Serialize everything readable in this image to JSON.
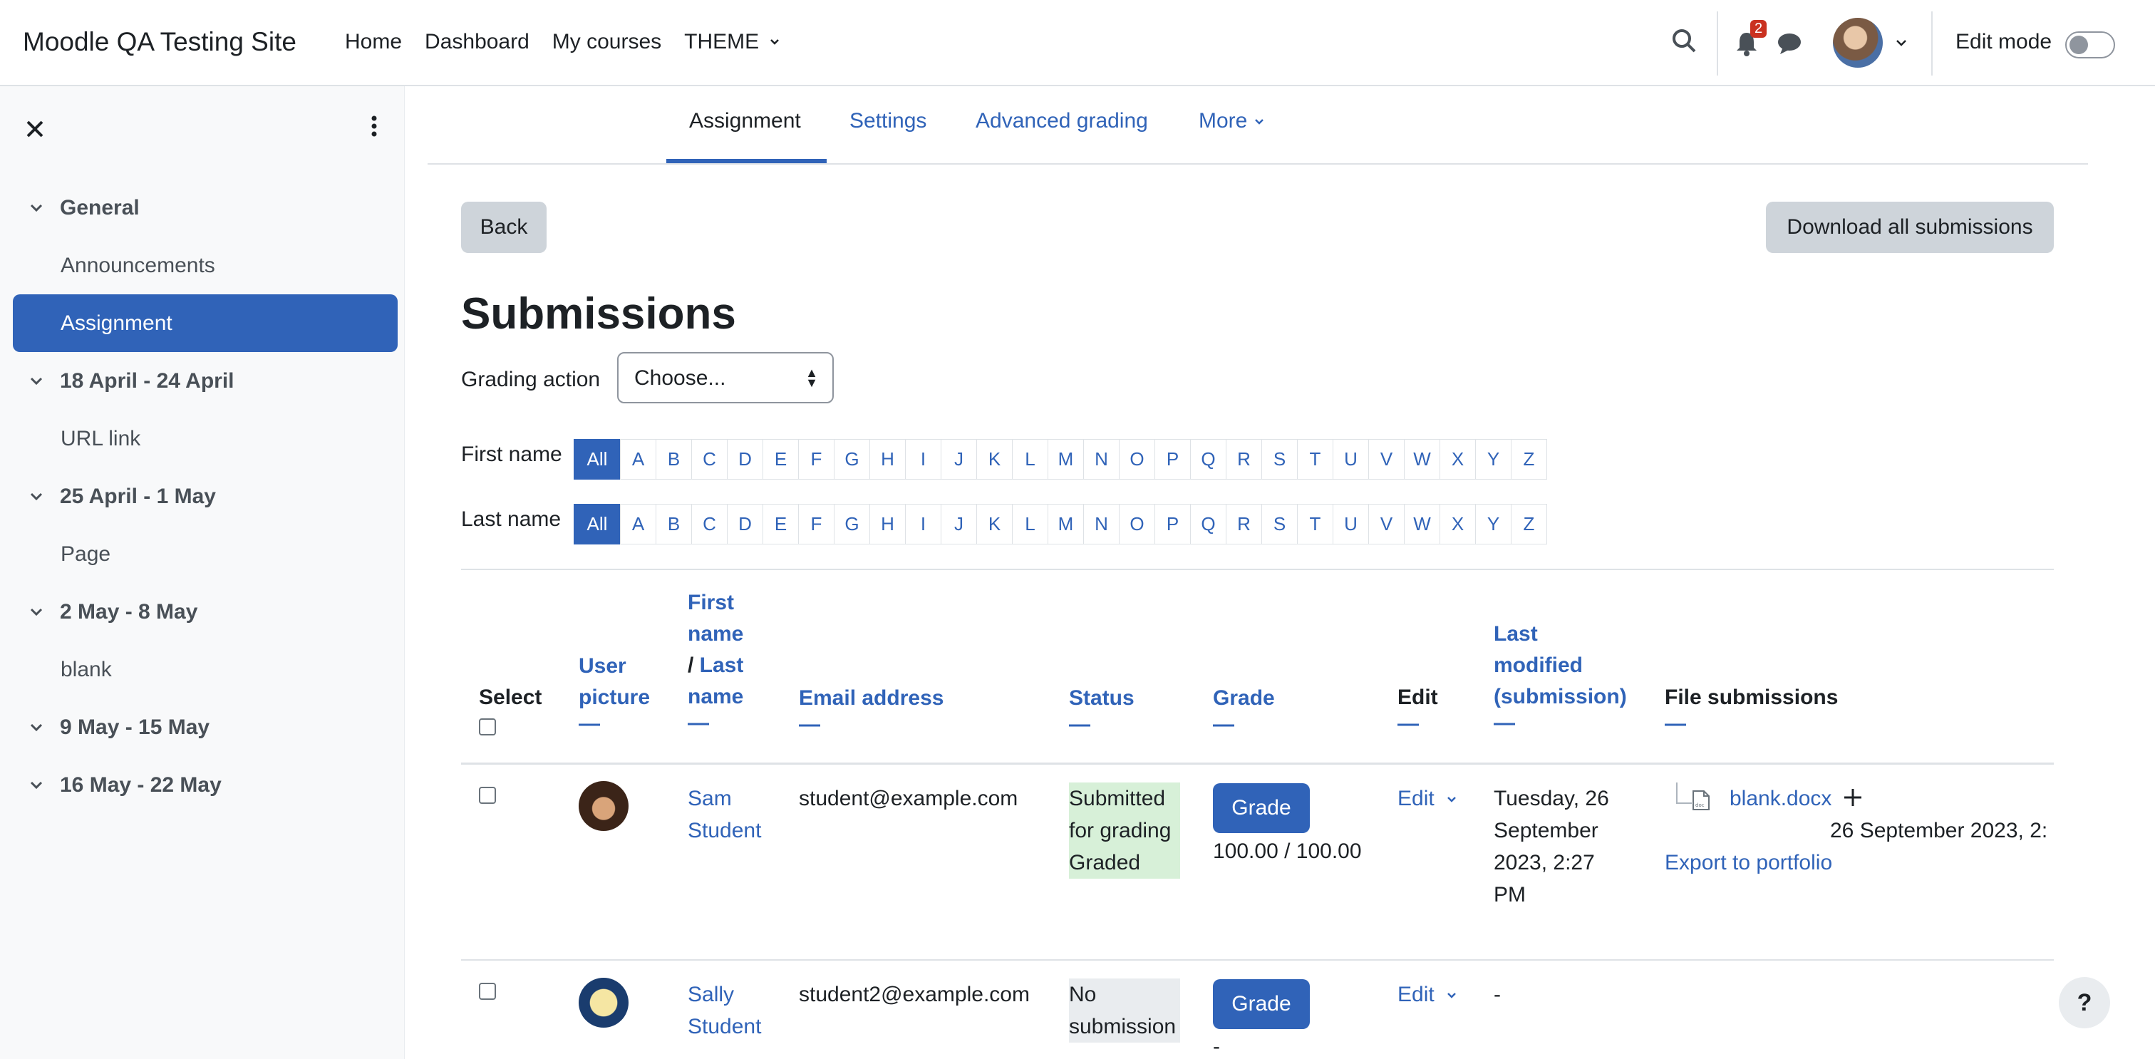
{
  "header": {
    "site_name": "Moodle QA Testing Site",
    "nav": [
      "Home",
      "Dashboard",
      "My courses",
      "THEME"
    ],
    "notification_count": "2",
    "edit_mode_label": "Edit mode"
  },
  "drawer": {
    "sections": [
      {
        "title": "General",
        "items": [
          "Announcements",
          "Assignment"
        ]
      },
      {
        "title": "18 April - 24 April",
        "items": [
          "URL link"
        ]
      },
      {
        "title": "25 April - 1 May",
        "items": [
          "Page"
        ]
      },
      {
        "title": "2 May - 8 May",
        "items": [
          "blank"
        ]
      },
      {
        "title": "9 May - 15 May",
        "items": []
      },
      {
        "title": "16 May - 22 May",
        "items": []
      }
    ],
    "active_item": "Assignment"
  },
  "secondary_nav": {
    "tabs": [
      "Assignment",
      "Settings",
      "Advanced grading",
      "More"
    ],
    "active": "Assignment"
  },
  "actions": {
    "back": "Back",
    "download": "Download all submissions"
  },
  "page": {
    "title": "Submissions",
    "grading_action_label": "Grading action",
    "grading_action_value": "Choose..."
  },
  "filters": {
    "first_name_label": "First name",
    "last_name_label": "Last name",
    "letters": [
      "All",
      "A",
      "B",
      "C",
      "D",
      "E",
      "F",
      "G",
      "H",
      "I",
      "J",
      "K",
      "L",
      "M",
      "N",
      "O",
      "P",
      "Q",
      "R",
      "S",
      "T",
      "U",
      "V",
      "W",
      "X",
      "Y",
      "Z"
    ]
  },
  "table": {
    "headers": {
      "select": "Select",
      "user_picture_1": "User",
      "user_picture_2": "picture",
      "first_name_1": "First",
      "first_name_2": "name",
      "slash": "/ ",
      "last_name_1": "Last",
      "last_name_2": "name",
      "email": "Email address",
      "status": "Status",
      "grade": "Grade",
      "edit": "Edit",
      "last_modified_1": "Last",
      "last_modified_2": "modified",
      "last_modified_3": "(submission)",
      "file_submissions": "File submissions",
      "dash": "—"
    },
    "rows": [
      {
        "first": "Sam",
        "last": "Student",
        "email": "student@example.com",
        "status_1": "Submitted",
        "status_2": "for grading",
        "status_3": "Graded",
        "grade_button": "Grade",
        "grade_value": "100.00 / 100.00",
        "edit": "Edit",
        "modified_1": "Tuesday, 26",
        "modified_2": "September",
        "modified_3": "2023, 2:27",
        "modified_4": "PM",
        "file": "blank.docx",
        "file_date": "26 September 2023, 2:",
        "export": "Export to portfolio"
      },
      {
        "first": "Sally",
        "last": "Student",
        "email": "student2@example.com",
        "status_1": "No",
        "status_2": "submission",
        "grade_button": "Grade",
        "grade_value": "-",
        "edit": "Edit",
        "modified_1": "-"
      }
    ]
  },
  "help": "?"
}
